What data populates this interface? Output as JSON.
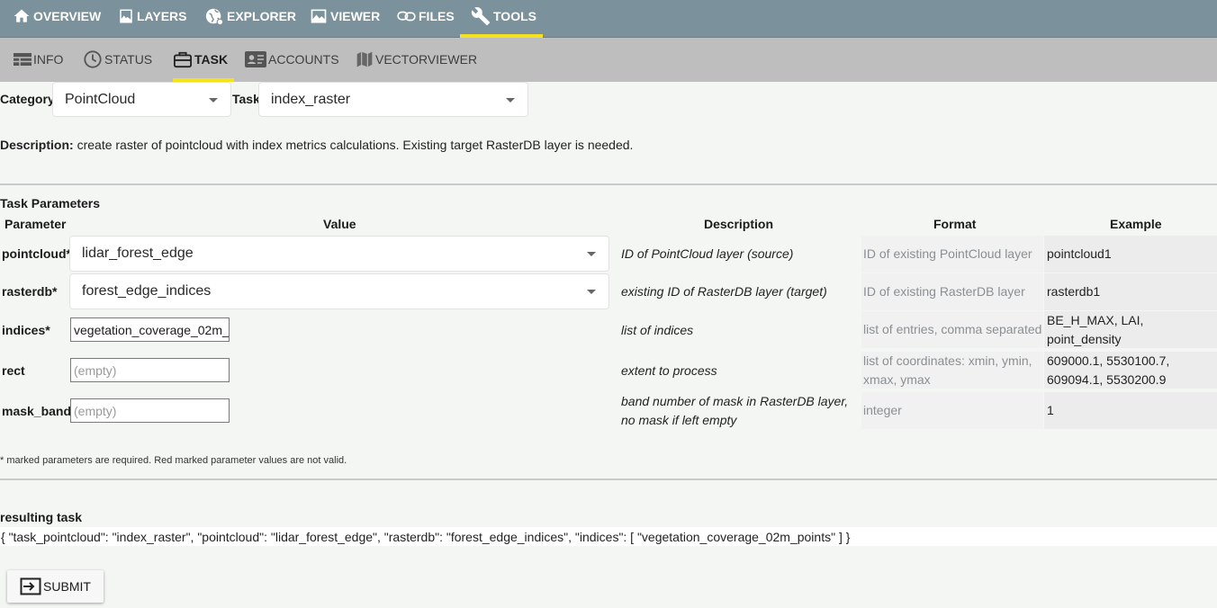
{
  "top_nav": {
    "overview": "OVERVIEW",
    "layers": "LAYERS",
    "explorer": "EXPLORER",
    "viewer": "VIEWER",
    "files": "FILES",
    "tools": "TOOLS"
  },
  "sub_nav": {
    "info": "INFO",
    "status": "STATUS",
    "task": "TASK",
    "accounts": "ACCOUNTS",
    "vectorviewer": "VECTORVIEWER"
  },
  "colors": {
    "top_nav_bg": "#7b919b",
    "sub_nav_bg": "#bebebe",
    "active_underline": "#f4e21e",
    "page_bg": "#f4f6f4"
  },
  "category": {
    "label": "Category",
    "value": "PointCloud"
  },
  "task": {
    "label": "Task",
    "value": "index_raster"
  },
  "description": {
    "label": "Description:",
    "text": "create raster of pointcloud with index metrics calculations. Existing target RasterDB layer is needed."
  },
  "params": {
    "section_title": "Task Parameters",
    "headers": {
      "parameter": "Parameter",
      "value": "Value",
      "description": "Description",
      "format": "Format",
      "example": "Example"
    },
    "rows": [
      {
        "name": "pointcloud*",
        "value": "lidar_forest_edge",
        "description": "ID of PointCloud layer (source)",
        "format": "ID of existing PointCloud layer",
        "example": "pointcloud1"
      },
      {
        "name": "rasterdb*",
        "value": "forest_edge_indices",
        "description": "existing ID of RasterDB layer (target)",
        "format": "ID of existing RasterDB layer",
        "example": "rasterdb1"
      },
      {
        "name": "indices*",
        "value": "vegetation_coverage_02m_",
        "description": "list of indices",
        "format": "list of entries, comma separated",
        "example": "BE_H_MAX, LAI, point_density"
      },
      {
        "name": "rect",
        "placeholder": "(empty)",
        "description": "extent to process",
        "format": "list of coordinates: xmin, ymin, xmax, ymax",
        "example": "609000.1, 5530100.7, 609094.1, 5530200.9"
      },
      {
        "name": "mask_band",
        "placeholder": "(empty)",
        "description": "band number of mask in RasterDB layer, no mask if left empty",
        "format": "integer",
        "example": "1"
      }
    ]
  },
  "note": "* marked parameters are required. Red marked parameter values are not valid.",
  "result": {
    "label": "resulting task",
    "json": "{ \"task_pointcloud\": \"index_raster\", \"pointcloud\": \"lidar_forest_edge\", \"rasterdb\": \"forest_edge_indices\", \"indices\": [ \"vegetation_coverage_02m_points\" ] }"
  },
  "submit_label": "SUBMIT",
  "icons": {
    "overview": "home-icon",
    "layers": "image-icon",
    "explorer": "globe-icon",
    "viewer": "photo-icon",
    "files": "link-icon",
    "tools": "wrench-icon",
    "info": "table-icon",
    "status": "clock-icon",
    "task": "briefcase-icon",
    "accounts": "account-card-icon",
    "vectorviewer": "map-icon",
    "submit": "submit-arrow-icon"
  }
}
